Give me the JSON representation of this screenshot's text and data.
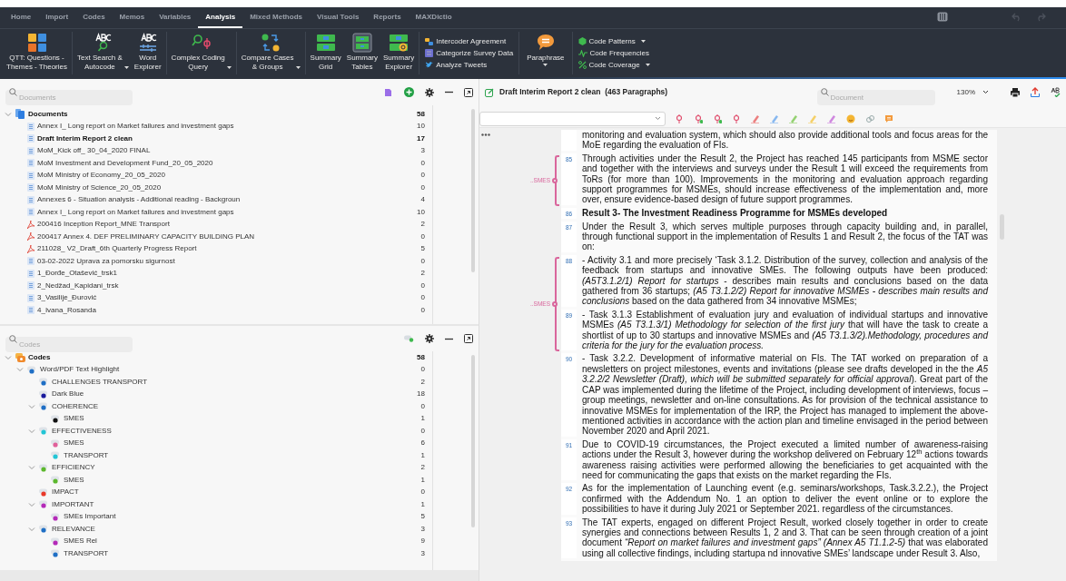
{
  "menu_tabs": [
    {
      "label": "Home",
      "selected": false
    },
    {
      "label": "Import",
      "selected": false
    },
    {
      "label": "Codes",
      "selected": false
    },
    {
      "label": "Memos",
      "selected": false
    },
    {
      "label": "Variables",
      "selected": false
    },
    {
      "label": "Analysis",
      "selected": true
    },
    {
      "label": "Mixed Methods",
      "selected": false
    },
    {
      "label": "Visual Tools",
      "selected": false
    },
    {
      "label": "Reports",
      "selected": false
    },
    {
      "label": "MAXDictio",
      "selected": false
    }
  ],
  "ribbon": {
    "big_button_groups": [
      [
        {
          "label": "QTT: Questions -\nThemes - Theories",
          "dropdown": false
        }
      ],
      [
        {
          "label": "Text Search &\nAutocode",
          "dropdown": true
        },
        {
          "label": "Word\nExplorer",
          "dropdown": false
        }
      ],
      [
        {
          "label": "Complex Coding\nQuery",
          "dropdown": true
        }
      ],
      [
        {
          "label": "Compare Cases\n& Groups",
          "dropdown": true
        }
      ],
      [
        {
          "label": "Summary\nGrid",
          "dropdown": false
        },
        {
          "label": "Summary\nTables",
          "dropdown": false
        },
        {
          "label": "Summary\nExplorer",
          "dropdown": false
        }
      ]
    ],
    "list_1": [
      {
        "label": "Intercoder Agreement",
        "dropdown": false
      },
      {
        "label": "Categorize Survey Data",
        "dropdown": false
      },
      {
        "label": "Analyze Tweets",
        "dropdown": false
      }
    ],
    "paraphrase": {
      "label": "Paraphrase",
      "dropdown": true
    },
    "list_2": [
      {
        "label": "Code Patterns",
        "dropdown": true
      },
      {
        "label": "Code Frequencies",
        "dropdown": false
      },
      {
        "label": "Code Coverage",
        "dropdown": true
      }
    ]
  },
  "documents_panel": {
    "search": {
      "placeholder": "Documents"
    },
    "root": {
      "label": "Documents",
      "count": "58",
      "expanded": true
    },
    "items": [
      {
        "kind": "text",
        "label": "Annex I_ Long report on Market failures and investment gaps",
        "count": "10",
        "selected": false
      },
      {
        "kind": "text",
        "label": "Draft Interim Report 2 clean",
        "count": "17",
        "selected": true
      },
      {
        "kind": "text",
        "label": "MoM_Kick off_ 30_04_2020 FINAL",
        "count": "3",
        "selected": false
      },
      {
        "kind": "text",
        "label": "MoM Investment and Development Fund_20_05_2020",
        "count": "0",
        "selected": false
      },
      {
        "kind": "text",
        "label": "MoM Ministry of Economy_20_05_2020",
        "count": "0",
        "selected": false
      },
      {
        "kind": "text",
        "label": "MoM Ministry of Science_20_05_2020",
        "count": "0",
        "selected": false
      },
      {
        "kind": "text",
        "label": "Annexes 6 - Situation analysis - Additional reading - Backgroun",
        "count": "4",
        "selected": false
      },
      {
        "kind": "text",
        "label": "Annex I_ Long report on Market failures and investment gaps",
        "count": "10",
        "selected": false
      },
      {
        "kind": "pdf",
        "label": "200416 Inception Report_MNE Transport",
        "count": "2",
        "selected": false
      },
      {
        "kind": "pdf",
        "label": "200417 Annex 4. DEF PRELIMINARY CAPACITY BUILDING PLAN",
        "count": "0",
        "selected": false
      },
      {
        "kind": "pdf",
        "label": "211028_ V2_Draft_6th Quarterly Progress Report",
        "count": "5",
        "selected": false
      },
      {
        "kind": "text",
        "label": "03-02-2022 Uprava za pomorsku sigurnost",
        "count": "0",
        "selected": false
      },
      {
        "kind": "text",
        "label": "1_Đorđe_Otašević_trsk1",
        "count": "2",
        "selected": false
      },
      {
        "kind": "text",
        "label": "2_Nedžad_Kapidani_trsk",
        "count": "0",
        "selected": false
      },
      {
        "kind": "text",
        "label": "3_Vasilije_Đurović",
        "count": "0",
        "selected": false
      },
      {
        "kind": "text",
        "label": "4_Ivana_Rosanda",
        "count": "0",
        "selected": false
      }
    ]
  },
  "codes_panel": {
    "search": {
      "placeholder": "Codes"
    },
    "root": {
      "label": "Codes",
      "count": "58",
      "expanded": true
    },
    "items": [
      {
        "label": "Word/PDF Text Highlight",
        "count": "0",
        "color": "#1f6fc5",
        "expanded": true,
        "children": [
          {
            "label": "CHALLENGES TRANSPORT",
            "count": "2",
            "color": "#1f6fc5"
          },
          {
            "label": "Dark Blue",
            "count": "18",
            "color": "#1a1a9c"
          },
          {
            "label": "COHERENCE",
            "count": "0",
            "color": "#1f6fc5",
            "expanded": true,
            "children": [
              {
                "label": "SMES",
                "count": "1",
                "color": "#111111"
              }
            ]
          },
          {
            "label": "EFFECTIVENESS",
            "count": "0",
            "color": "#22c5d5",
            "expanded": true,
            "children": [
              {
                "label": "SMES",
                "count": "6",
                "color": "#e0609a"
              },
              {
                "label": "TRANSPORT",
                "count": "1",
                "color": "#22c5d5"
              }
            ]
          },
          {
            "label": "EFFICIENCY",
            "count": "2",
            "color": "#5cb82e",
            "expanded": true,
            "children": [
              {
                "label": "SMES",
                "count": "1",
                "color": "#5cb82e"
              }
            ]
          },
          {
            "label": "IMPACT",
            "count": "0",
            "color": "#e8392a"
          },
          {
            "label": "IMPORTANT",
            "count": "1",
            "color": "#b42ab8",
            "expanded": true,
            "children": [
              {
                "label": "SMEs Important",
                "count": "5",
                "color": "#b42ab8"
              }
            ]
          },
          {
            "label": "RELEVANCE",
            "count": "3",
            "color": "#1f6fc5",
            "expanded": true,
            "children": [
              {
                "label": "SMES Rel",
                "count": "9",
                "color": "#b42ab8"
              },
              {
                "label": "TRANSPORT",
                "count": "3",
                "color": "#1f6fc5"
              }
            ]
          }
        ]
      }
    ]
  },
  "document_viewer": {
    "title": "Draft Interim Report 2 clean  (463 Paragraphs)",
    "search": {
      "placeholder": "Document"
    },
    "zoom": "130%",
    "blocks": [
      {
        "paragraphs": [
          {
            "kind": "body",
            "text": "monitoring and evaluation system, which should also provide additional tools and focus areas for the MoE regarding the evaluation of FIs."
          }
        ]
      },
      {
        "coding": {
          "label": "..SMES",
          "color": "#d9669c"
        },
        "paragraphs": [
          {
            "number": "85",
            "kind": "body",
            "text": "Through activities under the Result 2, the Project has reached 145 participants from MSME sector and together with the interviews and surveys under the Result 1 will exceed the requirements from ToRs (for more than 100). Improvements in the monitoring and evaluation approach regarding support programmes for MSMEs, should increase effectiveness of the implementation and, more over, ensure evidence-based design of future support programmes."
          }
        ]
      },
      {
        "paragraphs": [
          {
            "number": "86",
            "kind": "heading",
            "text": "Result 3- The Investment Readiness Programme for MSMEs developed"
          },
          {
            "number": "87",
            "kind": "body",
            "text": "Under the Result 3, which serves multiple purposes through capacity building and, in parallel, through functional support in the implementation of Results 1 and Result 2, the focus of the TAT was on:"
          }
        ]
      },
      {
        "coding": {
          "label": "..SMES",
          "color": "#d9669c"
        },
        "paragraphs": [
          {
            "number": "88",
            "kind": "body",
            "text": "- Activity 3.1 and more precisely ‘Task 3.1.2. Distribution of the survey, collection and analysis of the feedback from startups and innovative SMEs. The following outputs have been produced: *(A5T3.1.2/1) Report for startups* - describes main results and conclusions based on the data gathered from 36 startups; *(A5 T3.1.2/2) Report for innovative MSMEs - describes main results and conclusions* based on the data gathered from 34 innovative MSMEs;"
          },
          {
            "number": "89",
            "kind": "body",
            "text": "- Task 3.1.3 Establishment of evaluation jury and evaluation of individual startups and innovative MSMEs *(A5 T3.1.3/1) Methodology for selection of the first jury* that will have the task to create a shortlist of up to 30 startups and innovative MSMEs and *(A5 T3.1.3/2).Methodology, procedures and criteria for the jury for the evaluation process.*"
          }
        ]
      },
      {
        "paragraphs": [
          {
            "number": "90",
            "kind": "body",
            "text": "- Task 3.2.2. Development of informative material on FIs. The TAT worked on preparation of a newsletters on project milestones, events and invitations (please see drafts developed in the the *A5 3.2.2/2 Newsletter (Draft), which will be submitted separately for official approval*). Great part of the CAP was implemented during the lifetime of the Project, including development of interviews, focus – group meetings, newsletter and on-line consultations. As for provision of the technical assistance to innovative MSMEs for implementation of the IRP, the Project has managed to implement the above-mentioned activities in accordance with the action plan and timeline envisaged in the period between November 2020 and April 2021."
          },
          {
            "number": "91",
            "kind": "body",
            "text": "Due to COVID-19 circumstances, the Project executed a limited number of awareness-raising actions under the Result 3, however during the workshop delivered on February 12$^{th}$ actions towards awareness raising activities were performed allowing the beneficiaries to get acquainted with the need for communicating the gaps that exists on the market regarding the FIs."
          },
          {
            "number": "92",
            "kind": "body",
            "text": "As for the implementation of Launching event (e.g. seminars/workshops, Task.3.2.2.), the Project confirmed with the Addendum No. 1 an option to deliver the event online or to explore the possibilities to have it during July 2021 or September 2021. regardless of the circumstances."
          },
          {
            "number": "93",
            "kind": "body",
            "text": "The TAT experts, engaged on different Project Result, worked closely together in order to create synergies and connections between Results 1, 2 and 3. That can be seen through creation of a joint document *“Report on market failures and investment gaps” (Annex A5 T1.1.2-5)* that was elaborated using all collective findings, including startupa nd innovative SMEs’ landscape under Result 3. Also,"
          }
        ]
      }
    ]
  }
}
